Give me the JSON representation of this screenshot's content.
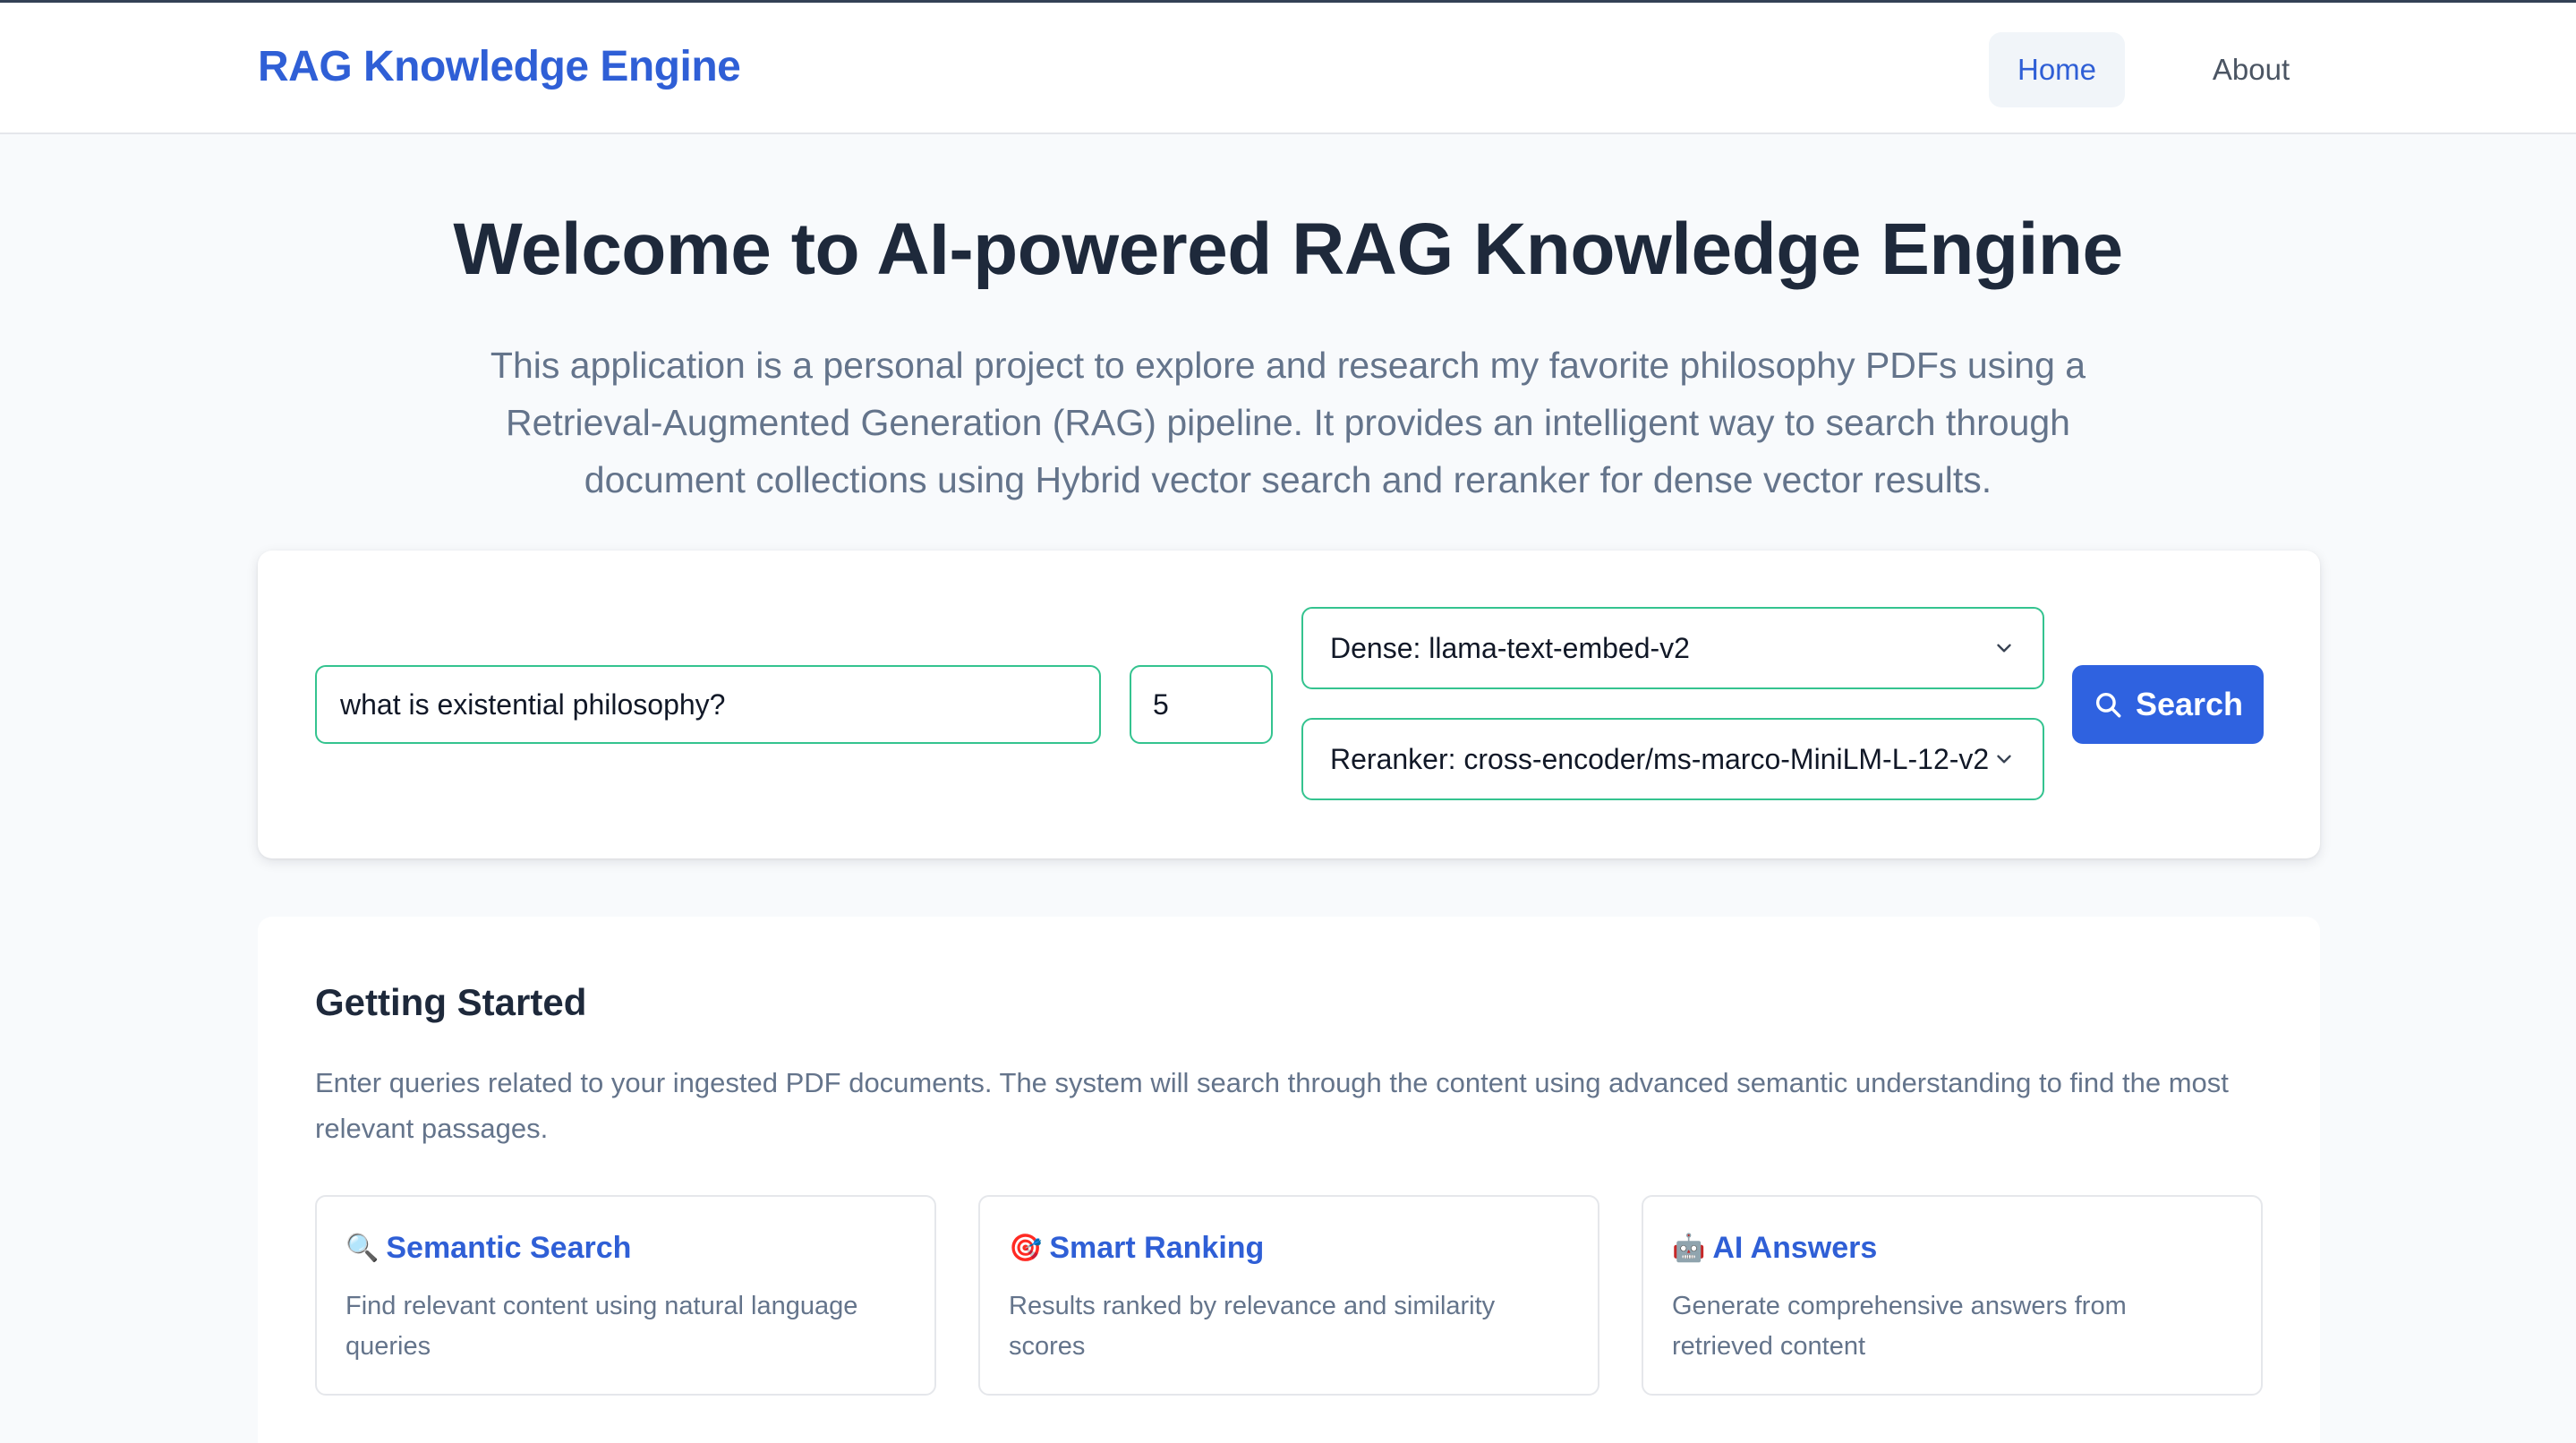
{
  "header": {
    "brand": "RAG Knowledge Engine",
    "nav": {
      "home": "Home",
      "about": "About"
    }
  },
  "hero": {
    "title": "Welcome to AI-powered RAG Knowledge Engine",
    "description": "This application is a personal project to explore and research my favorite philosophy PDFs using a Retrieval-Augmented Generation (RAG) pipeline. It provides an intelligent way to search through document collections using Hybrid vector search and reranker for dense vector results."
  },
  "search": {
    "query_value": "what is existential philosophy?",
    "top_k_value": "5",
    "dense_model": "Dense: llama-text-embed-v2",
    "reranker_model": "Reranker: cross-encoder/ms-marco-MiniLM-L-12-v2",
    "button_label": "Search",
    "button_icon": "search-icon"
  },
  "getting_started": {
    "title": "Getting Started",
    "description": "Enter queries related to your ingested PDF documents. The system will search through the content using advanced semantic understanding to find the most relevant passages.",
    "features": [
      {
        "icon": "🔍",
        "icon_name": "magnifier-icon",
        "title": "Semantic Search",
        "description": "Find relevant content using natural language queries"
      },
      {
        "icon": "🎯",
        "icon_name": "target-icon",
        "title": "Smart Ranking",
        "description": "Results ranked by relevance and similarity scores"
      },
      {
        "icon": "🤖",
        "icon_name": "robot-icon",
        "title": "AI Answers",
        "description": "Generate comprehensive answers from retrieved content"
      }
    ]
  },
  "colors": {
    "brand": "#2f5fd6",
    "button": "#2f62e0",
    "input_border": "#34c38f",
    "background": "#f8fafc"
  }
}
